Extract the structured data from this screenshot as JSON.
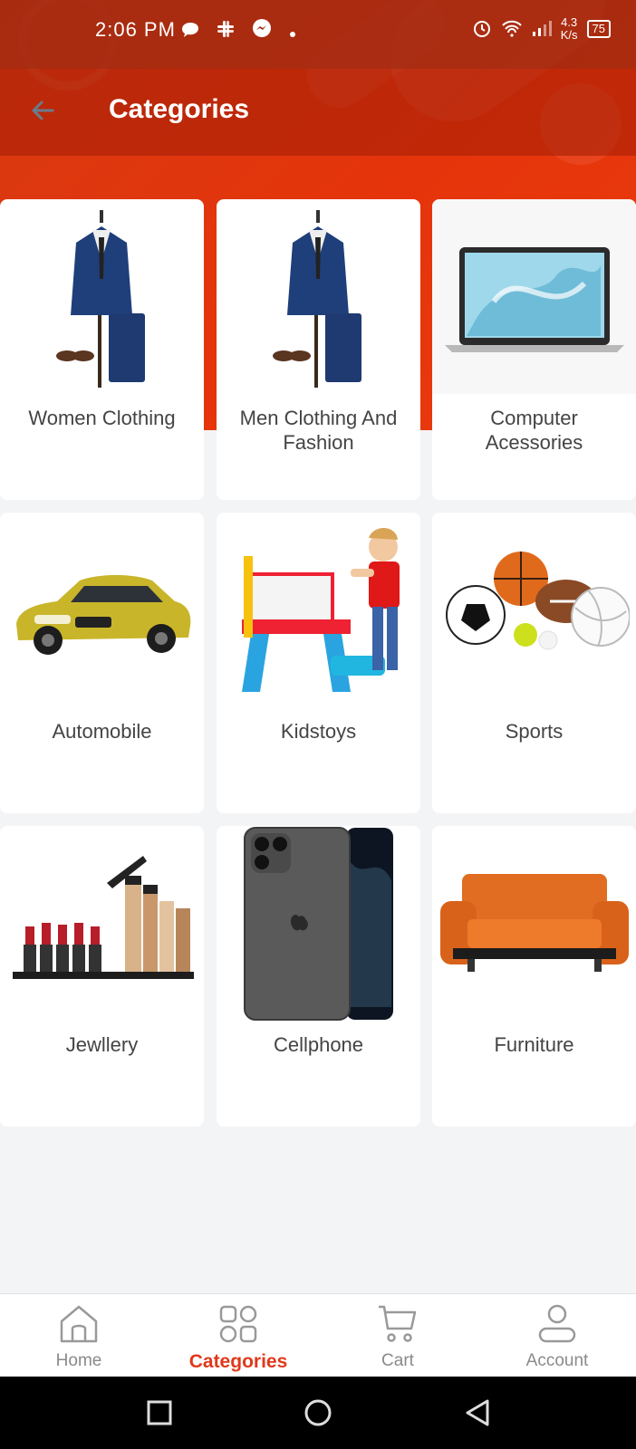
{
  "status_bar": {
    "time": "2:06 PM",
    "speed_value": "4.3",
    "speed_unit": "K/s",
    "battery": "75",
    "icons": [
      "chat-icon",
      "slack-icon",
      "messenger-icon",
      "dot-icon",
      "alarm-icon",
      "wifi-icon",
      "signal-icon",
      "battery-icon"
    ]
  },
  "app_bar": {
    "title": "Categories",
    "back_icon": "back-arrow-icon"
  },
  "categories": [
    {
      "label": "Women Clothing",
      "image": "suit-image"
    },
    {
      "label": "Men Clothing And Fashion",
      "image": "suit-image"
    },
    {
      "label": "Computer Acessories",
      "image": "laptop-image"
    },
    {
      "label": "Automobile",
      "image": "car-image"
    },
    {
      "label": "Kidstoys",
      "image": "kids-toy-image"
    },
    {
      "label": "Sports",
      "image": "sports-balls-image"
    },
    {
      "label": "Jewllery",
      "image": "cosmetics-image"
    },
    {
      "label": "Cellphone",
      "image": "iphone-image"
    },
    {
      "label": "Furniture",
      "image": "sofa-image"
    }
  ],
  "bottom_nav": {
    "items": [
      {
        "label": "Home",
        "icon": "home-icon",
        "active": false
      },
      {
        "label": "Categories",
        "icon": "categories-icon",
        "active": true
      },
      {
        "label": "Cart",
        "icon": "cart-icon",
        "active": false
      },
      {
        "label": "Account",
        "icon": "account-icon",
        "active": false
      }
    ]
  },
  "colors": {
    "accent": "#e0391b",
    "header": "#e5340b",
    "background": "#f3f4f6"
  }
}
